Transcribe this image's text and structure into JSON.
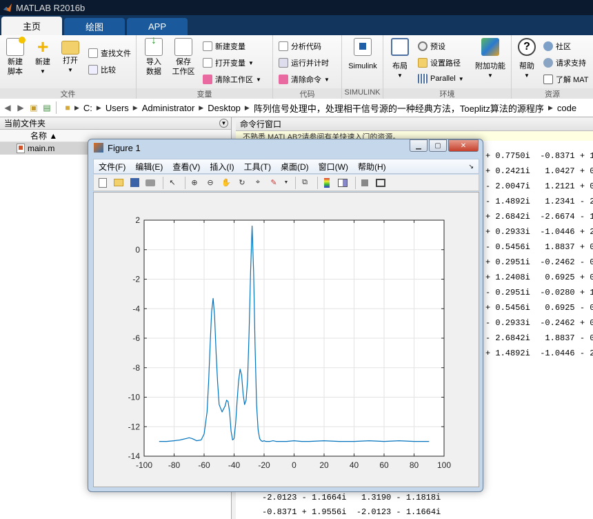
{
  "app": {
    "title": "MATLAB R2016b"
  },
  "tabs": [
    {
      "label": "主页"
    },
    {
      "label": "绘图"
    },
    {
      "label": "APP"
    }
  ],
  "ribbon": {
    "file": {
      "title": "文件",
      "new_script": [
        "新建",
        "脚本"
      ],
      "new": "新建",
      "open": "打开",
      "find_files": "查找文件",
      "compare": "比较"
    },
    "variable": {
      "title": "变量",
      "import": [
        "导入",
        "数据"
      ],
      "save": [
        "保存",
        "工作区"
      ],
      "new_var": "新建变量",
      "open_var": "打开变量",
      "clear_ws": "清除工作区"
    },
    "code": {
      "title": "代码",
      "analyze": "分析代码",
      "run_time": "运行并计时",
      "clear_cmd": "清除命令"
    },
    "simulink": {
      "title": "SIMULINK",
      "label": "Simulink"
    },
    "env": {
      "title": "环境",
      "layout": "布局",
      "prefs": "预设",
      "set_path": "设置路径",
      "parallel": "Parallel",
      "addons": "附加功能"
    },
    "resources": {
      "title": "资源",
      "help": "帮助",
      "community": "社区",
      "support": "请求支持",
      "learn": "了解 MAT"
    }
  },
  "address": {
    "parts": [
      "C:",
      "Users",
      "Administrator",
      "Desktop",
      "阵列信号处理中，处理相干信号源的一种经典方法，Toeplitz算法的源程序",
      "code"
    ]
  },
  "current_folder": {
    "title": "当前文件夹",
    "col_name": "名称 ▲",
    "files": [
      "main.m"
    ]
  },
  "command_window": {
    "title": "命令行窗口",
    "notice": "不熟悉 MATLAB?请参阅有关快速入门的资源。",
    "right_lines": [
      "+ 0.7750i  -0.8371 + 1",
      "+ 0.2421i   1.0427 + 0",
      "- 2.0047i   1.2121 + 0",
      "- 1.4892i   1.2341 - 2",
      "+ 2.6842i  -2.6674 - 1",
      "+ 0.2933i  -1.0446 + 2",
      "- 0.5456i   1.8837 + 0",
      "+ 0.2951i  -0.2462 - 0",
      "+ 1.2408i   0.6925 + 0",
      "- 0.2951i  -0.0280 + 1",
      "+ 0.5456i   0.6925 - 0",
      "- 0.2933i  -0.2462 + 0",
      "- 2.6842i   1.8837 - 0",
      "+ 1.4892i  -1.0446 - 2"
    ],
    "bottom_lines": [
      "-2.0123 - 1.1664i   1.3190 - 1.1818i",
      "-0.8371 + 1.9556i  -2.0123 - 1.1664i"
    ]
  },
  "figure": {
    "title": "Figure 1",
    "menu": [
      "文件(F)",
      "编辑(E)",
      "查看(V)",
      "插入(I)",
      "工具(T)",
      "桌面(D)",
      "窗口(W)",
      "帮助(H)"
    ]
  },
  "chart_data": {
    "type": "line",
    "title": "",
    "xlabel": "",
    "ylabel": "",
    "xlim": [
      -100,
      100
    ],
    "ylim": [
      -14,
      2
    ],
    "xticks": [
      -100,
      -80,
      -60,
      -40,
      -20,
      0,
      20,
      40,
      60,
      80,
      100
    ],
    "yticks": [
      2,
      0,
      -2,
      -4,
      -6,
      -8,
      -10,
      -12,
      -14
    ],
    "grid": true,
    "color": "#0072bd",
    "x": [
      -90,
      -85,
      -80,
      -76,
      -72,
      -70,
      -68,
      -65,
      -62,
      -60,
      -58,
      -57,
      -56,
      -55,
      -54,
      -53,
      -52,
      -51,
      -50,
      -48,
      -46,
      -45,
      -44,
      -43,
      -42,
      -41,
      -40,
      -39,
      -38,
      -37,
      -36,
      -35,
      -34,
      -33,
      -32,
      -31,
      -30,
      -29,
      -28,
      -27,
      -26,
      -25,
      -24,
      -23,
      -22,
      -21,
      -20,
      -19,
      -18,
      -16,
      -14,
      -12,
      -10,
      -5,
      0,
      5,
      10,
      20,
      30,
      40,
      50,
      60,
      70,
      80,
      85,
      90
    ],
    "y": [
      -13.0,
      -13.0,
      -12.95,
      -12.9,
      -12.8,
      -12.75,
      -12.8,
      -12.95,
      -12.9,
      -12.5,
      -11.0,
      -9.0,
      -6.5,
      -4.2,
      -3.3,
      -4.5,
      -7.0,
      -9.0,
      -10.5,
      -11.0,
      -10.6,
      -10.2,
      -10.3,
      -11.0,
      -12.3,
      -12.9,
      -12.8,
      -11.8,
      -10.3,
      -8.9,
      -8.1,
      -8.5,
      -9.8,
      -10.5,
      -10.2,
      -8.8,
      -5.5,
      -1.5,
      1.6,
      -1.5,
      -6.5,
      -10.5,
      -12.2,
      -12.8,
      -12.95,
      -13.0,
      -12.95,
      -13.0,
      -13.0,
      -13.0,
      -12.95,
      -13.0,
      -13.0,
      -13.0,
      -12.95,
      -13.0,
      -13.0,
      -12.95,
      -13.0,
      -13.0,
      -12.95,
      -13.0,
      -12.95,
      -13.0,
      -13.0,
      -13.0
    ]
  }
}
